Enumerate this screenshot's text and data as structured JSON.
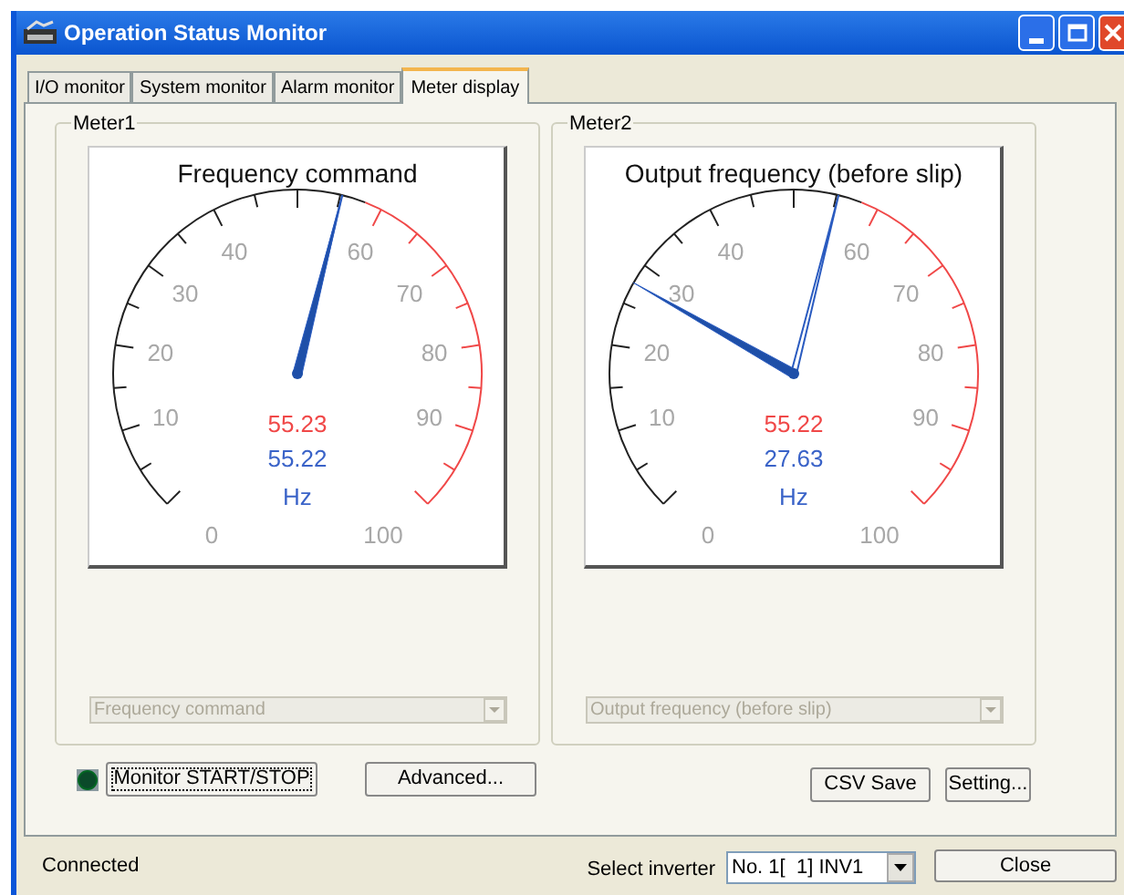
{
  "window": {
    "title": "Operation Status Monitor"
  },
  "tabs": [
    {
      "label": "I/O monitor",
      "selected": false
    },
    {
      "label": "System monitor",
      "selected": false
    },
    {
      "label": "Alarm monitor",
      "selected": false
    },
    {
      "label": "Meter display",
      "selected": true
    }
  ],
  "meters": [
    {
      "label": "Meter1",
      "title": "Frequency command",
      "scale_labels": [
        "0",
        "10",
        "20",
        "30",
        "40",
        "60",
        "70",
        "80",
        "90",
        "100"
      ],
      "unit": "Hz",
      "needles": [
        {
          "kind": "thin",
          "reading": "55.23"
        },
        {
          "kind": "thick",
          "reading": "55.22"
        }
      ],
      "dropdown": {
        "value": "Frequency command",
        "disabled": true
      }
    },
    {
      "label": "Meter2",
      "title": "Output frequency (before slip)",
      "scale_labels": [
        "0",
        "10",
        "20",
        "30",
        "40",
        "60",
        "70",
        "80",
        "90",
        "100"
      ],
      "unit": "Hz",
      "needles": [
        {
          "kind": "thin",
          "reading": "55.22"
        },
        {
          "kind": "thick",
          "reading": "27.63"
        }
      ],
      "dropdown": {
        "value": "Output frequency (before slip)",
        "disabled": true
      }
    }
  ],
  "buttons": {
    "left": [
      "Monitor START/STOP",
      "Advanced..."
    ],
    "right": [
      "CSV Save",
      "Setting..."
    ]
  },
  "status_bar": {
    "status": "Connected",
    "select_label": "Select inverter",
    "inverter": "No. 1[  1] INV1",
    "close": "Close"
  }
}
